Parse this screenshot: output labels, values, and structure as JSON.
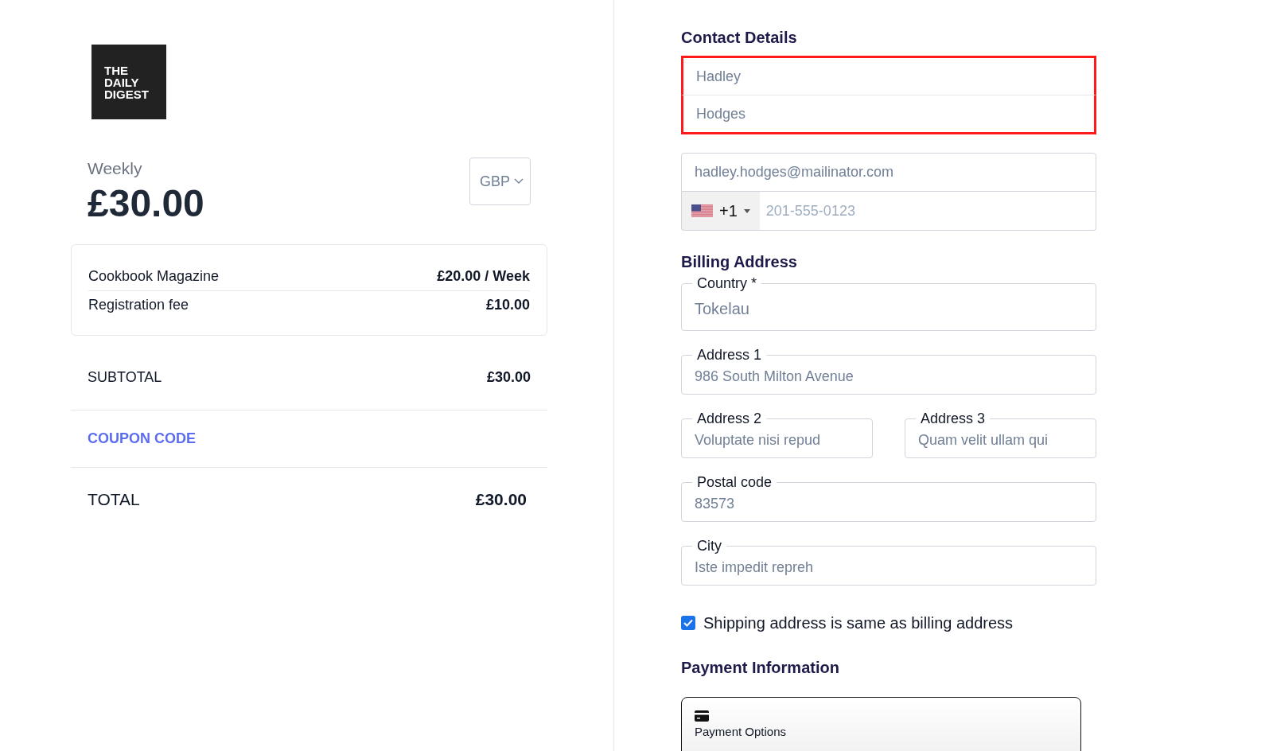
{
  "logo": {
    "lines": [
      "THE",
      "DAILY",
      "DIGEST"
    ]
  },
  "plan": {
    "period": "Weekly",
    "price": "£30.00",
    "currency": "GBP"
  },
  "line_items": [
    {
      "name": "Cookbook Magazine",
      "amount": "£20.00 / Week"
    },
    {
      "name": "Registration fee",
      "amount": "£10.00"
    }
  ],
  "subtotal": {
    "label": "SUBTOTAL",
    "amount": "£30.00"
  },
  "coupon": {
    "label": "COUPON CODE"
  },
  "total": {
    "label": "TOTAL",
    "amount": "£30.00"
  },
  "contact": {
    "title": "Contact Details",
    "first_name": "Hadley",
    "last_name": "Hodges",
    "email": "hadley.hodges@mailinator.com",
    "phone_code": "+1",
    "phone_placeholder": "201-555-0123"
  },
  "billing": {
    "title": "Billing Address",
    "fields": [
      {
        "label": "Country *",
        "value": "Tokelau",
        "kind": "large"
      },
      {
        "label": "Address 1",
        "value": "986 South Milton Avenue",
        "kind": "full"
      },
      {
        "label": "Address 2",
        "value": "Voluptate nisi repud",
        "kind": "half"
      },
      {
        "label": "Address 3",
        "value": "Quam velit ullam qui",
        "kind": "half"
      },
      {
        "label": "Postal code",
        "value": "83573",
        "kind": "full"
      },
      {
        "label": "City",
        "value": "Iste impedit repreh",
        "kind": "full"
      }
    ]
  },
  "same_address": {
    "label": "Shipping address is same as billing address",
    "checked": true
  },
  "payment": {
    "title": "Payment Information",
    "option_label": "Payment Options"
  }
}
